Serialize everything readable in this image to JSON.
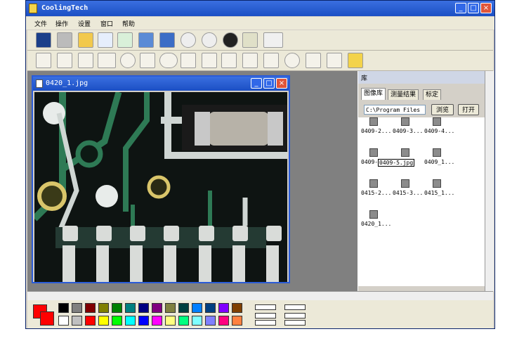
{
  "app": {
    "title": "CoolingTech"
  },
  "menu": [
    "文件",
    "操作",
    "设置",
    "窗口",
    "帮助"
  ],
  "toolbar1": [
    "capture-icon",
    "camera-icon",
    "open-folder-icon",
    "save-doc-icon",
    "export-icon",
    "refresh-icon",
    "save-icon",
    "pause-icon",
    "stop-icon",
    "wrench-icon",
    "ruler-vertical-icon",
    "ruler-horizontal-icon"
  ],
  "toolbar2": [
    "line-tool-icon",
    "zoom-icon",
    "rotate-icon",
    "rectangle-tool-icon",
    "circle-tool-icon",
    "polyline-tool-icon",
    "ellipse-tool-icon",
    "height-tool-icon",
    "measure-tool-icon",
    "angle-tool-icon",
    "parallel-tool-icon",
    "angle-measure-icon",
    "circle-measure-icon",
    "caliper-icon",
    "arrow-measure-icon",
    "palette-icon"
  ],
  "image_window": {
    "title": "0420_1.jpg"
  },
  "library": {
    "title": "库",
    "tabs": [
      "图像库",
      "测量结果",
      "标定"
    ],
    "path": "C:\\Program Files",
    "browse": "浏览",
    "open": "打开",
    "thumbs": [
      "0409-2...",
      "0409-3...",
      "0409-4...",
      "0409-...",
      "0409-5.jpg",
      "0409_1...",
      "0415-2...",
      "0415-3...",
      "0415_1...",
      "0420_1..."
    ]
  },
  "palette_colors_top": [
    "#000000",
    "#808080",
    "#800000",
    "#808000",
    "#008000",
    "#008080",
    "#000080",
    "#800080",
    "#808040",
    "#004040",
    "#0080ff",
    "#004080",
    "#8000ff",
    "#804000"
  ],
  "palette_colors_bottom": [
    "#ffffff",
    "#c0c0c0",
    "#ff0000",
    "#ffff00",
    "#00ff00",
    "#00ffff",
    "#0000ff",
    "#ff00ff",
    "#ffff80",
    "#00ff80",
    "#80ffff",
    "#8080ff",
    "#ff0080",
    "#ff8040"
  ]
}
